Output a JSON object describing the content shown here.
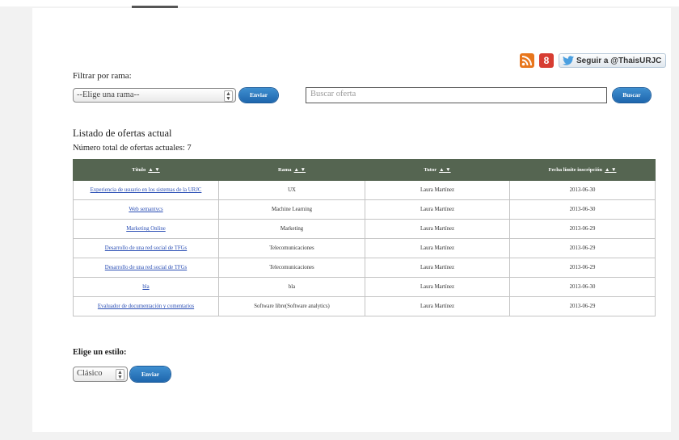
{
  "social": {
    "rss_icon": "rss-icon",
    "gplus_label": "8",
    "follow_label": "Seguir a @ThaisURJC"
  },
  "filter": {
    "label": "Filtrar por rama:",
    "branch_select_value": "--Elige una rama--",
    "submit_label": "Enviar",
    "search_placeholder": "Buscar oferta",
    "search_button_label": "Buscar"
  },
  "listing": {
    "title": "Listado de ofertas actual",
    "total_text": "Número total de ofertas actuales: 7",
    "sort_glyphs": "▲ ▼",
    "columns": [
      "Título",
      "Rama",
      "Tutor",
      "Fecha límite inscripción"
    ],
    "rows": [
      {
        "titulo": "Experiencia de usuario en los sistemas de la URJC",
        "rama": "UX",
        "tutor": "Laura Martínez",
        "fecha": "2013-06-30"
      },
      {
        "titulo": "Web semantycs",
        "rama": "Machine Learning",
        "tutor": "Laura Martínez",
        "fecha": "2013-06-30"
      },
      {
        "titulo": "Marketing Online",
        "rama": "Marketing",
        "tutor": "Laura Martínez",
        "fecha": "2013-06-29"
      },
      {
        "titulo": "Desarrollo de una red social de TFGs",
        "rama": "Telecomunicaciones",
        "tutor": "Laura Martínez",
        "fecha": "2013-06-29"
      },
      {
        "titulo": "Desarrollo de una red social de TFGs",
        "rama": "Telecomunicaciones",
        "tutor": "Laura Martínez",
        "fecha": "2013-06-29"
      },
      {
        "titulo": "bla",
        "rama": "bla",
        "tutor": "Laura Martínez",
        "fecha": "2013-06-30"
      },
      {
        "titulo": "Evaluador de documentación y comentarios",
        "rama": "Software libre(Software analytics)",
        "tutor": "Laura Martínez",
        "fecha": "2013-06-29"
      }
    ]
  },
  "style_chooser": {
    "label": "Elige un estilo:",
    "select_value": "Clásico",
    "submit_label": "Enviar"
  },
  "colors": {
    "header_bg": "#556551",
    "button_blue": "#2a7bc4",
    "link": "#2b4fb5"
  }
}
